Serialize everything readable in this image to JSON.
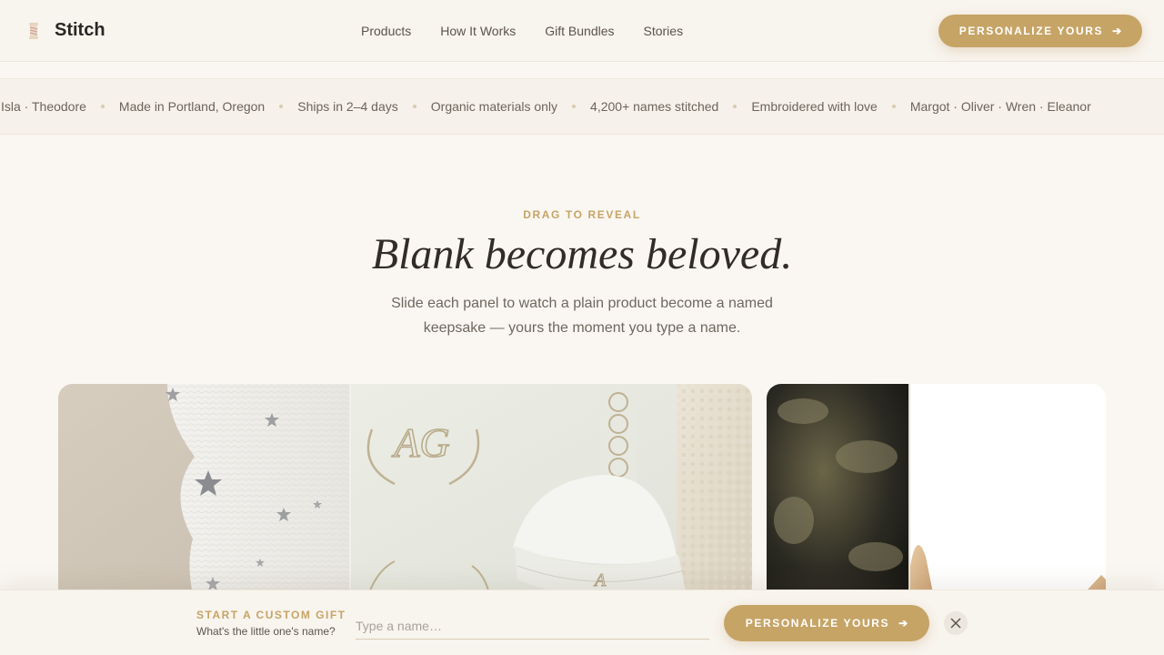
{
  "brand": {
    "name": "Stitch",
    "icon": "spool-icon"
  },
  "nav": {
    "items": [
      {
        "label": "Products"
      },
      {
        "label": "How It Works"
      },
      {
        "label": "Gift Bundles"
      },
      {
        "label": "Stories"
      }
    ],
    "cta_label": "PERSONALIZE YOURS",
    "cta_icon": "arrow-right-icon"
  },
  "marquee": {
    "items": [
      "Isla · Theodore",
      "Made in Portland, Oregon",
      "Ships in 2–4 days",
      "Organic materials only",
      "4,200+ names stitched",
      "Embroidered with love",
      "Margot · Oliver · Wren · Eleanor"
    ]
  },
  "hero": {
    "eyebrow": "DRAG TO REVEAL",
    "title": "Blank becomes beloved.",
    "subtitle": "Slide each panel to watch a plain product become a named keepsake — yours the moment you type a name."
  },
  "panels": [
    {
      "monogram": "AG",
      "hat_initial": "A"
    },
    {
      "monogram": ""
    }
  ],
  "bottom_bar": {
    "label": "START A CUSTOM GIFT",
    "sublabel": "What's the little one's name?",
    "input_value": "",
    "input_placeholder": "Type a name…",
    "cta_label": "PERSONALIZE YOURS",
    "close_icon": "close-icon"
  },
  "colors": {
    "accent": "#c6a466",
    "background": "#faf7f2",
    "text": "#2e2a26"
  }
}
